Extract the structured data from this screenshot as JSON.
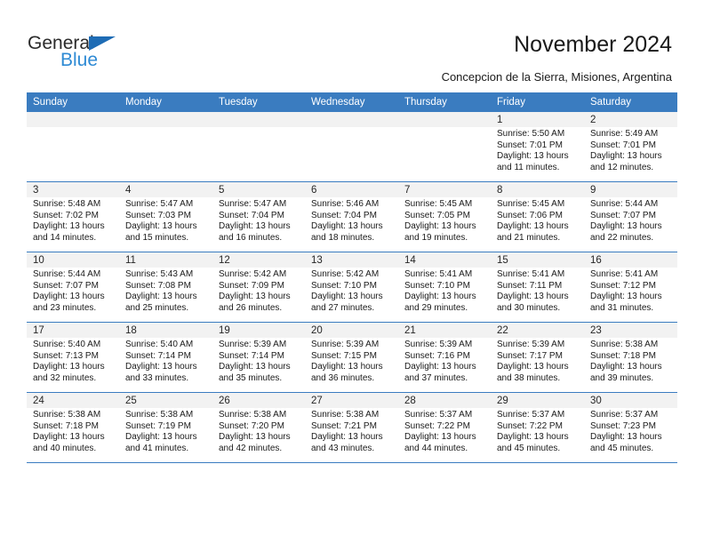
{
  "brand": {
    "name_part1": "General",
    "name_part2": "Blue",
    "accent_color": "#2e8ad4",
    "triangle_color": "#1e6cb5"
  },
  "header": {
    "title": "November 2024",
    "subtitle": "Concepcion de la Sierra, Misiones, Argentina"
  },
  "theme": {
    "header_blue": "#3a7cc0",
    "daynum_band": "#f2f2f2",
    "grid_line": "#3a7cc0"
  },
  "weekday_headers": [
    "Sunday",
    "Monday",
    "Tuesday",
    "Wednesday",
    "Thursday",
    "Friday",
    "Saturday"
  ],
  "weeks": [
    [
      {
        "day": "",
        "empty": true,
        "sunrise": "",
        "sunset": "",
        "daylight_line1": "",
        "daylight_line2": ""
      },
      {
        "day": "",
        "empty": true,
        "sunrise": "",
        "sunset": "",
        "daylight_line1": "",
        "daylight_line2": ""
      },
      {
        "day": "",
        "empty": true,
        "sunrise": "",
        "sunset": "",
        "daylight_line1": "",
        "daylight_line2": ""
      },
      {
        "day": "",
        "empty": true,
        "sunrise": "",
        "sunset": "",
        "daylight_line1": "",
        "daylight_line2": ""
      },
      {
        "day": "",
        "empty": true,
        "sunrise": "",
        "sunset": "",
        "daylight_line1": "",
        "daylight_line2": ""
      },
      {
        "day": "1",
        "empty": false,
        "sunrise": "Sunrise: 5:50 AM",
        "sunset": "Sunset: 7:01 PM",
        "daylight_line1": "Daylight: 13 hours",
        "daylight_line2": "and 11 minutes."
      },
      {
        "day": "2",
        "empty": false,
        "sunrise": "Sunrise: 5:49 AM",
        "sunset": "Sunset: 7:01 PM",
        "daylight_line1": "Daylight: 13 hours",
        "daylight_line2": "and 12 minutes."
      }
    ],
    [
      {
        "day": "3",
        "empty": false,
        "sunrise": "Sunrise: 5:48 AM",
        "sunset": "Sunset: 7:02 PM",
        "daylight_line1": "Daylight: 13 hours",
        "daylight_line2": "and 14 minutes."
      },
      {
        "day": "4",
        "empty": false,
        "sunrise": "Sunrise: 5:47 AM",
        "sunset": "Sunset: 7:03 PM",
        "daylight_line1": "Daylight: 13 hours",
        "daylight_line2": "and 15 minutes."
      },
      {
        "day": "5",
        "empty": false,
        "sunrise": "Sunrise: 5:47 AM",
        "sunset": "Sunset: 7:04 PM",
        "daylight_line1": "Daylight: 13 hours",
        "daylight_line2": "and 16 minutes."
      },
      {
        "day": "6",
        "empty": false,
        "sunrise": "Sunrise: 5:46 AM",
        "sunset": "Sunset: 7:04 PM",
        "daylight_line1": "Daylight: 13 hours",
        "daylight_line2": "and 18 minutes."
      },
      {
        "day": "7",
        "empty": false,
        "sunrise": "Sunrise: 5:45 AM",
        "sunset": "Sunset: 7:05 PM",
        "daylight_line1": "Daylight: 13 hours",
        "daylight_line2": "and 19 minutes."
      },
      {
        "day": "8",
        "empty": false,
        "sunrise": "Sunrise: 5:45 AM",
        "sunset": "Sunset: 7:06 PM",
        "daylight_line1": "Daylight: 13 hours",
        "daylight_line2": "and 21 minutes."
      },
      {
        "day": "9",
        "empty": false,
        "sunrise": "Sunrise: 5:44 AM",
        "sunset": "Sunset: 7:07 PM",
        "daylight_line1": "Daylight: 13 hours",
        "daylight_line2": "and 22 minutes."
      }
    ],
    [
      {
        "day": "10",
        "empty": false,
        "sunrise": "Sunrise: 5:44 AM",
        "sunset": "Sunset: 7:07 PM",
        "daylight_line1": "Daylight: 13 hours",
        "daylight_line2": "and 23 minutes."
      },
      {
        "day": "11",
        "empty": false,
        "sunrise": "Sunrise: 5:43 AM",
        "sunset": "Sunset: 7:08 PM",
        "daylight_line1": "Daylight: 13 hours",
        "daylight_line2": "and 25 minutes."
      },
      {
        "day": "12",
        "empty": false,
        "sunrise": "Sunrise: 5:42 AM",
        "sunset": "Sunset: 7:09 PM",
        "daylight_line1": "Daylight: 13 hours",
        "daylight_line2": "and 26 minutes."
      },
      {
        "day": "13",
        "empty": false,
        "sunrise": "Sunrise: 5:42 AM",
        "sunset": "Sunset: 7:10 PM",
        "daylight_line1": "Daylight: 13 hours",
        "daylight_line2": "and 27 minutes."
      },
      {
        "day": "14",
        "empty": false,
        "sunrise": "Sunrise: 5:41 AM",
        "sunset": "Sunset: 7:10 PM",
        "daylight_line1": "Daylight: 13 hours",
        "daylight_line2": "and 29 minutes."
      },
      {
        "day": "15",
        "empty": false,
        "sunrise": "Sunrise: 5:41 AM",
        "sunset": "Sunset: 7:11 PM",
        "daylight_line1": "Daylight: 13 hours",
        "daylight_line2": "and 30 minutes."
      },
      {
        "day": "16",
        "empty": false,
        "sunrise": "Sunrise: 5:41 AM",
        "sunset": "Sunset: 7:12 PM",
        "daylight_line1": "Daylight: 13 hours",
        "daylight_line2": "and 31 minutes."
      }
    ],
    [
      {
        "day": "17",
        "empty": false,
        "sunrise": "Sunrise: 5:40 AM",
        "sunset": "Sunset: 7:13 PM",
        "daylight_line1": "Daylight: 13 hours",
        "daylight_line2": "and 32 minutes."
      },
      {
        "day": "18",
        "empty": false,
        "sunrise": "Sunrise: 5:40 AM",
        "sunset": "Sunset: 7:14 PM",
        "daylight_line1": "Daylight: 13 hours",
        "daylight_line2": "and 33 minutes."
      },
      {
        "day": "19",
        "empty": false,
        "sunrise": "Sunrise: 5:39 AM",
        "sunset": "Sunset: 7:14 PM",
        "daylight_line1": "Daylight: 13 hours",
        "daylight_line2": "and 35 minutes."
      },
      {
        "day": "20",
        "empty": false,
        "sunrise": "Sunrise: 5:39 AM",
        "sunset": "Sunset: 7:15 PM",
        "daylight_line1": "Daylight: 13 hours",
        "daylight_line2": "and 36 minutes."
      },
      {
        "day": "21",
        "empty": false,
        "sunrise": "Sunrise: 5:39 AM",
        "sunset": "Sunset: 7:16 PM",
        "daylight_line1": "Daylight: 13 hours",
        "daylight_line2": "and 37 minutes."
      },
      {
        "day": "22",
        "empty": false,
        "sunrise": "Sunrise: 5:39 AM",
        "sunset": "Sunset: 7:17 PM",
        "daylight_line1": "Daylight: 13 hours",
        "daylight_line2": "and 38 minutes."
      },
      {
        "day": "23",
        "empty": false,
        "sunrise": "Sunrise: 5:38 AM",
        "sunset": "Sunset: 7:18 PM",
        "daylight_line1": "Daylight: 13 hours",
        "daylight_line2": "and 39 minutes."
      }
    ],
    [
      {
        "day": "24",
        "empty": false,
        "sunrise": "Sunrise: 5:38 AM",
        "sunset": "Sunset: 7:18 PM",
        "daylight_line1": "Daylight: 13 hours",
        "daylight_line2": "and 40 minutes."
      },
      {
        "day": "25",
        "empty": false,
        "sunrise": "Sunrise: 5:38 AM",
        "sunset": "Sunset: 7:19 PM",
        "daylight_line1": "Daylight: 13 hours",
        "daylight_line2": "and 41 minutes."
      },
      {
        "day": "26",
        "empty": false,
        "sunrise": "Sunrise: 5:38 AM",
        "sunset": "Sunset: 7:20 PM",
        "daylight_line1": "Daylight: 13 hours",
        "daylight_line2": "and 42 minutes."
      },
      {
        "day": "27",
        "empty": false,
        "sunrise": "Sunrise: 5:38 AM",
        "sunset": "Sunset: 7:21 PM",
        "daylight_line1": "Daylight: 13 hours",
        "daylight_line2": "and 43 minutes."
      },
      {
        "day": "28",
        "empty": false,
        "sunrise": "Sunrise: 5:37 AM",
        "sunset": "Sunset: 7:22 PM",
        "daylight_line1": "Daylight: 13 hours",
        "daylight_line2": "and 44 minutes."
      },
      {
        "day": "29",
        "empty": false,
        "sunrise": "Sunrise: 5:37 AM",
        "sunset": "Sunset: 7:22 PM",
        "daylight_line1": "Daylight: 13 hours",
        "daylight_line2": "and 45 minutes."
      },
      {
        "day": "30",
        "empty": false,
        "sunrise": "Sunrise: 5:37 AM",
        "sunset": "Sunset: 7:23 PM",
        "daylight_line1": "Daylight: 13 hours",
        "daylight_line2": "and 45 minutes."
      }
    ]
  ]
}
